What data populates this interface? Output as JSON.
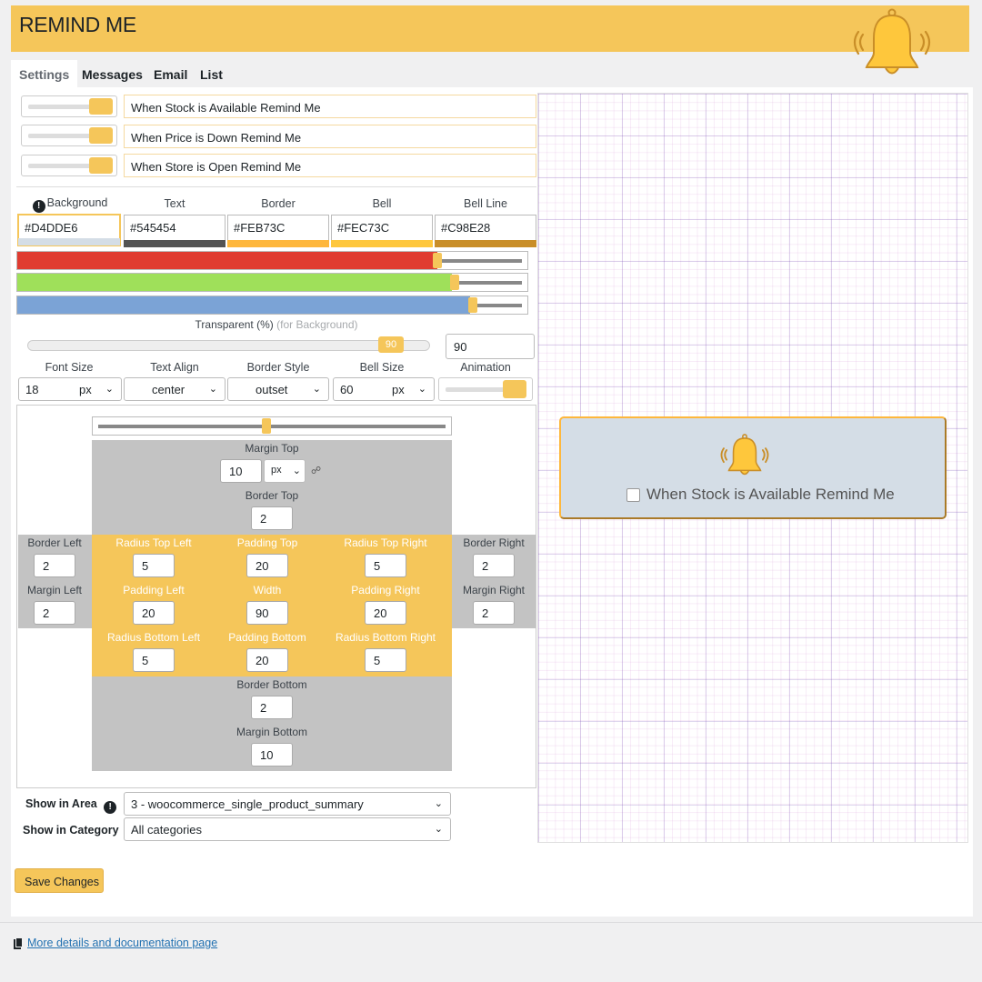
{
  "header": {
    "title": "REMIND ME",
    "bg_color": "#f5c65a"
  },
  "tabs": [
    {
      "label": "Settings",
      "active": true
    },
    {
      "label": "Messages",
      "active": false
    },
    {
      "label": "Email",
      "active": false
    },
    {
      "label": "List",
      "active": false
    }
  ],
  "reminders": [
    {
      "label": "When Stock is Available Remind Me",
      "enabled": true
    },
    {
      "label": "When Price is Down Remind Me",
      "enabled": true
    },
    {
      "label": "When Store is Open Remind Me",
      "enabled": true
    }
  ],
  "colors": {
    "background": {
      "label": "Background",
      "value": "#D4DDE6"
    },
    "text": {
      "label": "Text",
      "value": "#545454"
    },
    "border": {
      "label": "Border",
      "value": "#FEB73C"
    },
    "bell": {
      "label": "Bell",
      "value": "#FEC73C"
    },
    "bell_line": {
      "label": "Bell Line",
      "value": "#C98E28"
    }
  },
  "rgb_sliders": {
    "red": 0.82,
    "green": 0.85,
    "blue": 0.89
  },
  "transparency": {
    "label": "Transparent (%)",
    "hint": "(for Background)",
    "value": "90",
    "input_value": "90"
  },
  "typography": {
    "font_size": {
      "label": "Font Size",
      "value": "18",
      "unit": "px"
    },
    "text_align": {
      "label": "Text Align",
      "value": "center"
    },
    "border_style": {
      "label": "Border Style",
      "value": "outset"
    },
    "bell_size": {
      "label": "Bell Size",
      "value": "60",
      "unit": "px"
    },
    "animation": {
      "label": "Animation",
      "enabled": true
    }
  },
  "box_model": {
    "slider_level": 0.48,
    "margin_top": {
      "label": "Margin Top",
      "value": "10",
      "unit": "px"
    },
    "border_top": {
      "label": "Border Top",
      "value": "2"
    },
    "border_left": {
      "label": "Border Left",
      "value": "2"
    },
    "margin_left": {
      "label": "Margin Left",
      "value": "2"
    },
    "border_right": {
      "label": "Border Right",
      "value": "2"
    },
    "margin_right": {
      "label": "Margin Right",
      "value": "2"
    },
    "radius_top_left": {
      "label": "Radius Top Left",
      "value": "5"
    },
    "padding_top": {
      "label": "Padding Top",
      "value": "20"
    },
    "radius_top_right": {
      "label": "Radius Top Right",
      "value": "5"
    },
    "padding_left": {
      "label": "Padding Left",
      "value": "20"
    },
    "width": {
      "label": "Width",
      "value": "90"
    },
    "padding_right": {
      "label": "Padding Right",
      "value": "20"
    },
    "radius_bottom_left": {
      "label": "Radius Bottom Left",
      "value": "5"
    },
    "padding_bottom": {
      "label": "Padding Bottom",
      "value": "20"
    },
    "radius_bottom_right": {
      "label": "Radius Bottom Right",
      "value": "5"
    },
    "border_bottom": {
      "label": "Border Bottom",
      "value": "2"
    },
    "margin_bottom": {
      "label": "Margin Bottom",
      "value": "10"
    }
  },
  "placement": {
    "area": {
      "label": "Show in Area",
      "value": "3 - woocommerce_single_product_summary"
    },
    "category": {
      "label": "Show in Category",
      "value": "All categories"
    }
  },
  "preview": {
    "text": "When Stock is Available Remind Me"
  },
  "actions": {
    "save_label": "Save Changes"
  },
  "footer": {
    "doc_link": "More details and documentation page"
  }
}
